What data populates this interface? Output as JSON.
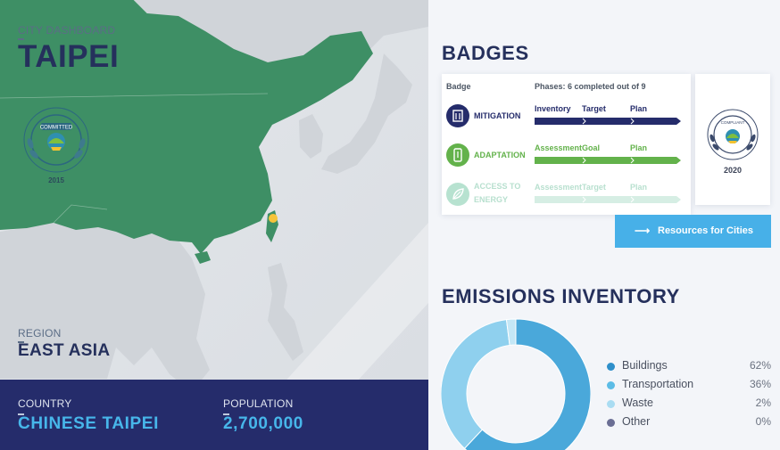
{
  "city": {
    "dashboard_label": "CITY DASHBOARD",
    "name": "TAIPEI",
    "region_label": "REGION",
    "region": "EAST ASIA",
    "country_label": "COUNTRY",
    "country": "CHINESE TAIPEI",
    "population_label": "POPULATION",
    "population": "2,700,000",
    "committed_seal": {
      "text": "COMMITTED",
      "year": "2015"
    },
    "map_marker_color": "#f6c43a"
  },
  "badges": {
    "title": "BADGES",
    "column_badge": "Badge",
    "phases_summary": "Phases: 6 completed out of 9",
    "rows": [
      {
        "name_lines": [
          "MITIGATION"
        ],
        "icon": "building-icon",
        "color": "#252c6b",
        "enabled": true,
        "phases": [
          "Inventory",
          "Target",
          "Plan"
        ]
      },
      {
        "name_lines": [
          "ADAPTATION"
        ],
        "icon": "phone-icon",
        "color": "#63b24b",
        "enabled": true,
        "phases": [
          "Assessment",
          "Goal",
          "Plan"
        ]
      },
      {
        "name_lines": [
          "ACCESS TO",
          "ENERGY"
        ],
        "icon": "leaf-icon",
        "color": "#b7e2d0",
        "enabled": false,
        "phases": [
          "Assessment",
          "Target",
          "Plan"
        ]
      }
    ],
    "compliant": {
      "text": "COMPLIANT",
      "year": "2020"
    },
    "resources_button": "Resources for Cities"
  },
  "emissions": {
    "title": "EMISSIONS INVENTORY",
    "legend": [
      {
        "name": "Buildings",
        "pct": "62%",
        "color": "#2e8fca"
      },
      {
        "name": "Transportation",
        "pct": "36%",
        "color": "#5cbce6"
      },
      {
        "name": "Waste",
        "pct": "2%",
        "color": "#a9dcf2"
      },
      {
        "name": "Other",
        "pct": "0%",
        "color": "#6a6e94"
      }
    ]
  },
  "chart_data": {
    "type": "pie",
    "categories": [
      "Buildings",
      "Transportation",
      "Waste",
      "Other"
    ],
    "values": [
      62,
      36,
      2,
      0
    ],
    "colors": [
      "#4aa8da",
      "#8fd0ee",
      "#c4e7f6",
      "#6a6e94"
    ]
  }
}
